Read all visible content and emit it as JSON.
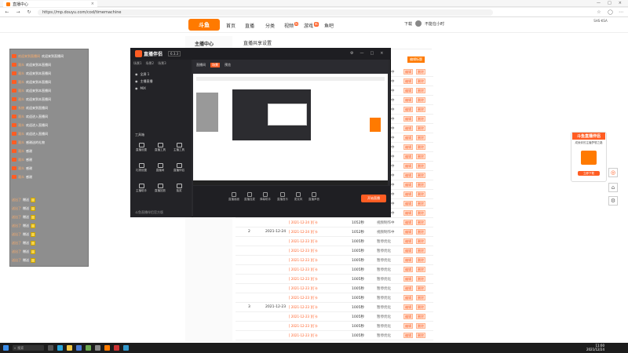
{
  "browser": {
    "tab_title": "直播中心",
    "url": "https://mp.douyu.com/cod/timemachine"
  },
  "site": {
    "logo_text": "斗鱼",
    "nav": [
      {
        "label": "首页"
      },
      {
        "label": "直播"
      },
      {
        "label": "分类"
      },
      {
        "label": "视频",
        "badge": "N"
      },
      {
        "label": "游戏",
        "badge": "新"
      },
      {
        "label": "鱼吧"
      }
    ],
    "download_label": "下载",
    "user_name": "不能在小时",
    "sidebar_title": "主播中心",
    "page_title": "直播共享设置",
    "orange_badge": "编辑标题",
    "table_rows": [
      {
        "num": "2",
        "date": "2021-12-24",
        "link": "[ 2021-12-24 ]打卡",
        "dur": "1052秒",
        "status": "视频制作中"
      },
      {
        "num": "3",
        "date": "2021-12-23",
        "link": "[ 2021-12-23 ]打卡",
        "dur": "1005秒",
        "status": "暂停优化"
      }
    ],
    "op_edit": "编辑",
    "op_del": "删除"
  },
  "chat": {
    "lines": [
      {
        "name": "欢迎来到直播间",
        "text": "欢迎来到直播间"
      },
      {
        "name": "观众",
        "text": "欢迎来到本直播间"
      },
      {
        "name": "观众",
        "text": "欢迎来到本直播间"
      },
      {
        "name": "观众",
        "text": "欢迎来到本直播间"
      },
      {
        "name": "观众",
        "text": "欢迎来到本直播间"
      },
      {
        "name": "观众",
        "text": "欢迎来到本直播间"
      },
      {
        "name": "系统",
        "text": "欢迎来到直播间"
      },
      {
        "name": "观众",
        "text": "欢迎进入直播间"
      },
      {
        "name": "观众",
        "text": "欢迎进入直播间"
      },
      {
        "name": "观众",
        "text": "欢迎进入直播间"
      },
      {
        "name": "观众",
        "text": "感谢送的礼物"
      },
      {
        "name": "观众",
        "text": "感谢"
      },
      {
        "name": "观众",
        "text": "感谢"
      },
      {
        "name": "观众",
        "text": "感谢"
      },
      {
        "name": "观众",
        "text": "感谢"
      }
    ],
    "check_lines": [
      {
        "name": "送出了",
        "text": "赠送"
      },
      {
        "name": "送出了",
        "text": "赠送"
      },
      {
        "name": "送出了",
        "text": "赠送"
      },
      {
        "name": "送出了",
        "text": "赠送"
      },
      {
        "name": "送出了",
        "text": "赠送"
      },
      {
        "name": "送出了",
        "text": "赠送"
      },
      {
        "name": "送出了",
        "text": "赠送"
      },
      {
        "name": "送出了",
        "text": "赠送"
      }
    ]
  },
  "companion": {
    "title": "直播伴侣",
    "version": "6.3.3",
    "side_tabs": [
      "场景1",
      "场景2",
      "场景3"
    ],
    "scenes": [
      {
        "label": "全屏 1"
      },
      {
        "label": "主播直播"
      },
      {
        "label": "MIX"
      }
    ],
    "section_label": "工具箱",
    "tools": [
      {
        "label": "直播设置"
      },
      {
        "label": "直播工具"
      },
      {
        "label": "主播工具"
      },
      {
        "label": "礼物设置"
      },
      {
        "label": "直播间"
      },
      {
        "label": "直播伴侣"
      },
      {
        "label": "主播助手"
      },
      {
        "label": "直播回放"
      },
      {
        "label": "抽奖"
      }
    ],
    "preview_tabs": [
      "直播间",
      "场景",
      "预览"
    ],
    "bottom_tools": [
      {
        "label": "直播画面"
      },
      {
        "label": "直播连麦"
      },
      {
        "label": "弹幕助手"
      },
      {
        "label": "直播音乐"
      },
      {
        "label": "麦克风"
      },
      {
        "label": "直播声音"
      }
    ],
    "go_live": "开始直播",
    "footer_note": "斗鱼直播伴侣官方版"
  },
  "promo": {
    "title": "斗鱼直播伴侣",
    "subtitle": "成就你的主播梦想之路",
    "button": "立即下载"
  },
  "top_right_text": "SHS-KSA",
  "taskbar": {
    "search_placeholder": "搜索",
    "time": "11:00",
    "date": "2021/12/24"
  }
}
